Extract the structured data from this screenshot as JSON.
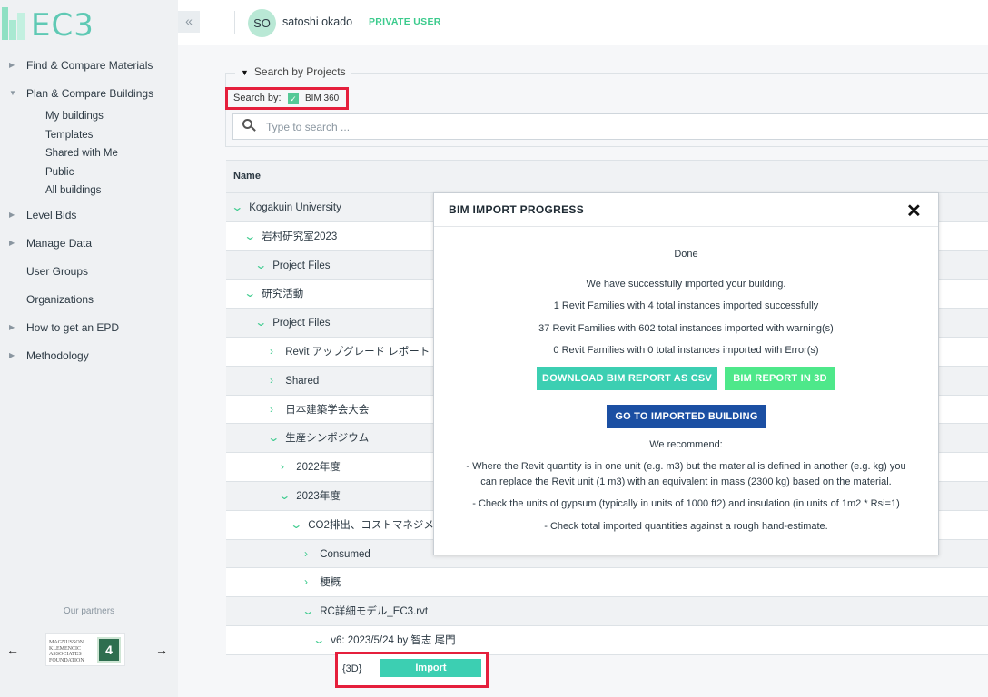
{
  "brand": {
    "logo_text": "EC3"
  },
  "user": {
    "initials": "SO",
    "name": "satoshi okado",
    "badge": "PRIVATE USER"
  },
  "sidebar": {
    "items": [
      {
        "label": "Find & Compare Materials",
        "caret": "▶"
      },
      {
        "label": "Plan & Compare Buildings",
        "caret": "▼"
      },
      {
        "label": "Level Bids",
        "caret": "▶"
      },
      {
        "label": "Manage Data",
        "caret": "▶"
      },
      {
        "label": "User Groups",
        "caret": ""
      },
      {
        "label": "Organizations",
        "caret": ""
      },
      {
        "label": "How to get an EPD",
        "caret": "▶"
      },
      {
        "label": "Methodology",
        "caret": "▶"
      }
    ],
    "subitems": [
      "My buildings",
      "Templates",
      "Shared with Me",
      "Public",
      "All buildings"
    ],
    "partners_label": "Our partners",
    "partner_logo_text": "MAGNUSSON KLEMENCIC ASSOCIATES FOUNDATION",
    "partner_logo_mark": "4"
  },
  "search": {
    "legend": "Search by Projects",
    "by_label": "Search by:",
    "by_value": "BIM 360",
    "placeholder": "Type to search ..."
  },
  "table": {
    "header": "Name",
    "rows": [
      {
        "label": "Kogakuin University",
        "chev": "⌄"
      },
      {
        "label": "岩村研究室2023",
        "chev": "⌄"
      },
      {
        "label": "Project Files",
        "chev": "⌄"
      },
      {
        "label": "研究活動",
        "chev": "⌄"
      },
      {
        "label": "Project Files",
        "chev": "⌄"
      },
      {
        "label": "Revit アップグレード レポート",
        "chev": "›"
      },
      {
        "label": "Shared",
        "chev": "›"
      },
      {
        "label": "日本建築学会大会",
        "chev": "›"
      },
      {
        "label": "生産シンポジウム",
        "chev": "⌄"
      },
      {
        "label": "2022年度",
        "chev": "›"
      },
      {
        "label": "2023年度",
        "chev": "⌄"
      },
      {
        "label": "CO2排出、コストマネジメント",
        "chev": "⌄"
      },
      {
        "label": "Consumed",
        "chev": "›"
      },
      {
        "label": "梗概",
        "chev": "›"
      },
      {
        "label": "RC詳細モデル_EC3.rvt",
        "chev": "⌄"
      },
      {
        "label": "v6: 2023/5/24 by 智志 尾門",
        "chev": "⌄"
      }
    ],
    "view_tag": "{3D}",
    "import_label": "Import"
  },
  "modal": {
    "title": "BIM IMPORT PROGRESS",
    "close": "✕",
    "status": "Done",
    "success": "We have successfully imported your building.",
    "line1": "1 Revit Families with 4 total instances imported successfully",
    "line2": "37 Revit Families with 602 total instances imported with warning(s)",
    "line3": "0 Revit Families with 0 total instances imported with Error(s)",
    "btn_csv": "DOWNLOAD BIM REPORT AS CSV",
    "btn_3d": "BIM REPORT IN 3D",
    "btn_goto": "GO TO IMPORTED BUILDING",
    "recommend": "We recommend:",
    "rec1a": "- Where the Revit quantity is in one unit (e.g. m3) but the material is defined in another (e.g. kg) you",
    "rec1b": "can replace the Revit unit (1 m3) with an equivalent in mass (2300 kg) based on the material.",
    "rec2": "- Check the units of gypsum (typically in units of 1000 ft2) and insulation (in units of 1m2 * Rsi=1)",
    "rec3": "- Check total imported quantities against a rough hand-estimate."
  },
  "colors": {
    "accent": "#3ccfb2",
    "accent_green": "#4ee88a",
    "primary": "#1b4fa3",
    "highlight": "#e51f3c"
  }
}
